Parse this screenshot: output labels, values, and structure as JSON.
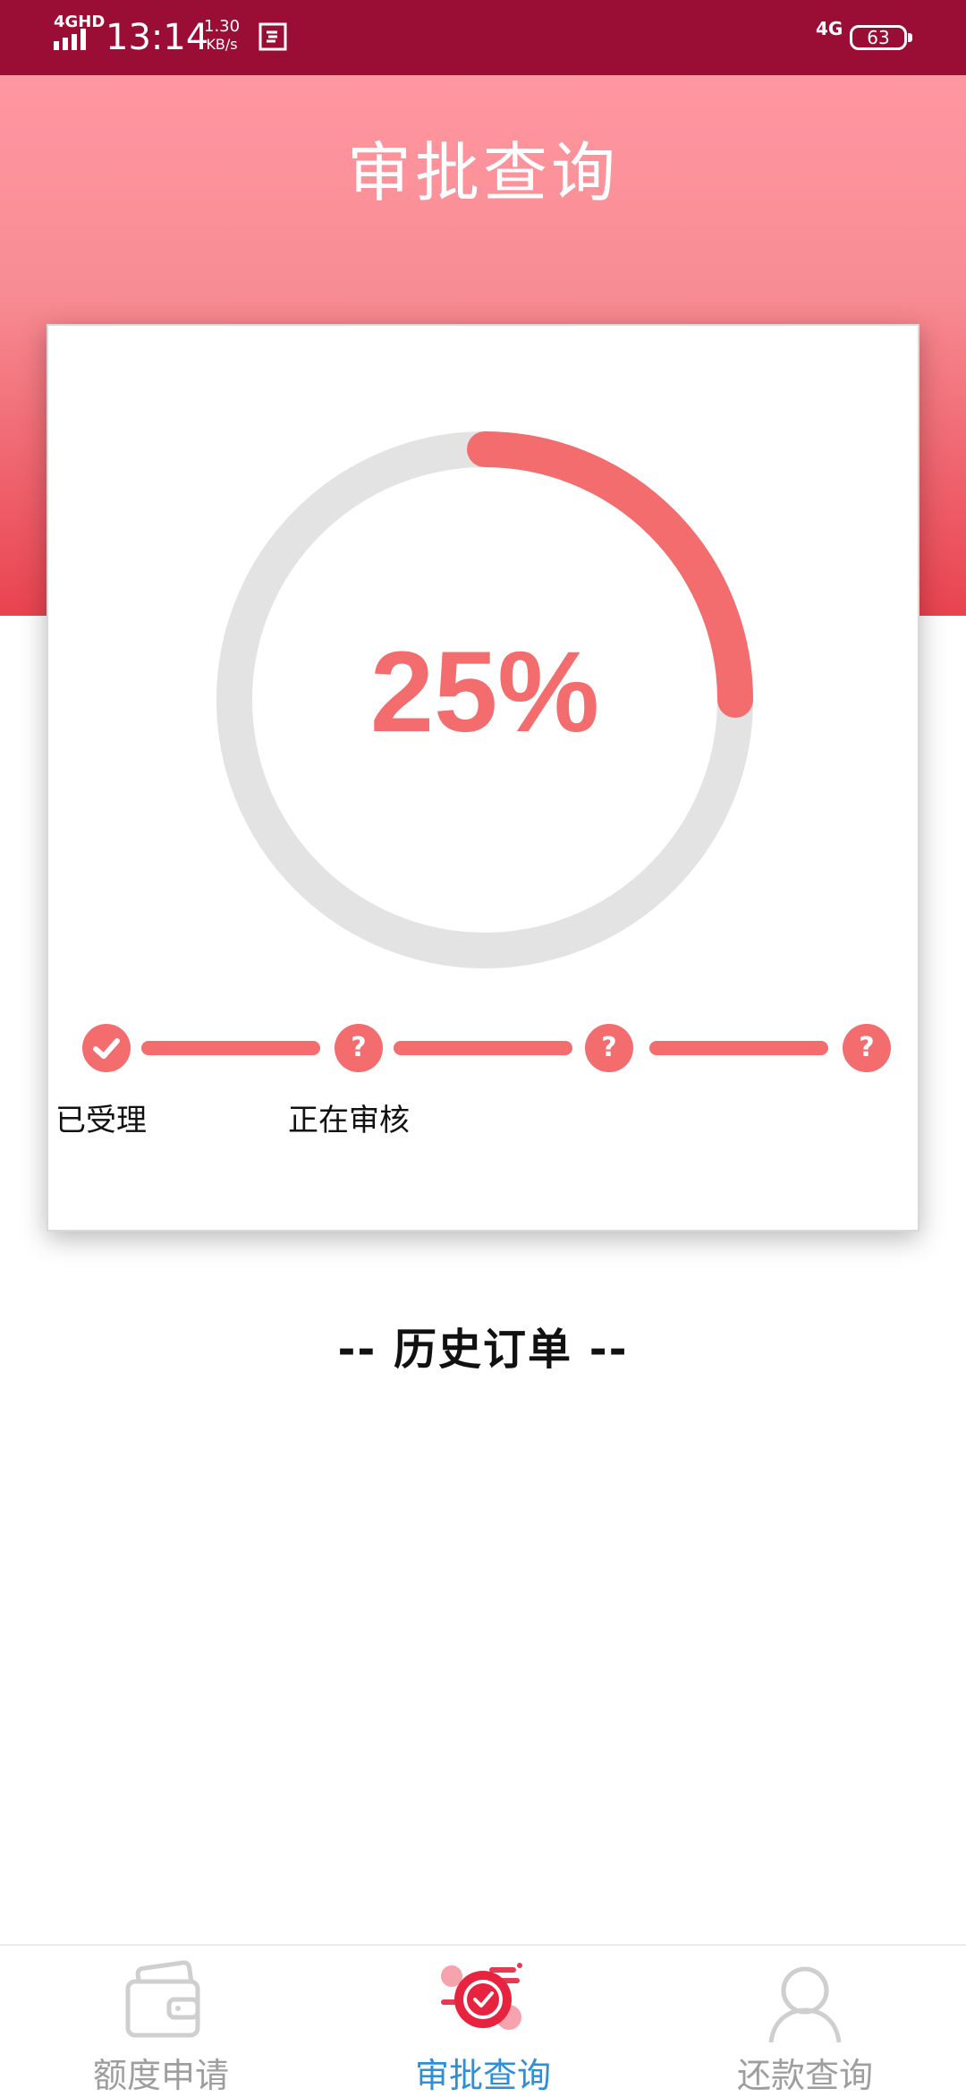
{
  "status_bar": {
    "network": "4GHD",
    "time": "13:14",
    "speed_value": "1.30",
    "speed_unit": "KB/s",
    "network_type": "4G",
    "battery": "63"
  },
  "header": {
    "title": "审批查询"
  },
  "progress": {
    "percent_text": "25%",
    "percent_value": 0.25,
    "accent_color": "#f36c6e",
    "track_color": "#e3e3e3"
  },
  "steps": [
    {
      "label": "已受理",
      "status": "done",
      "icon": "check-icon"
    },
    {
      "label": "正在审核",
      "status": "pending",
      "icon": "question-icon"
    },
    {
      "label": "",
      "status": "pending",
      "icon": "question-icon"
    },
    {
      "label": "",
      "status": "pending",
      "icon": "question-icon"
    }
  ],
  "step_question_mark": "?",
  "history": {
    "title": "-- 历史订单 --"
  },
  "bottom_nav": [
    {
      "label": "额度申请",
      "icon": "wallet-icon",
      "active": false
    },
    {
      "label": "审批查询",
      "icon": "approval-check-icon",
      "active": true
    },
    {
      "label": "还款查询",
      "icon": "user-icon",
      "active": false
    }
  ],
  "colors": {
    "status_bar": "#9a0d34",
    "header_top": "#ff97a0",
    "header_bottom": "#e8434f",
    "nav_active": "#2f8fd6",
    "nav_inactive": "#9e9e9e"
  }
}
